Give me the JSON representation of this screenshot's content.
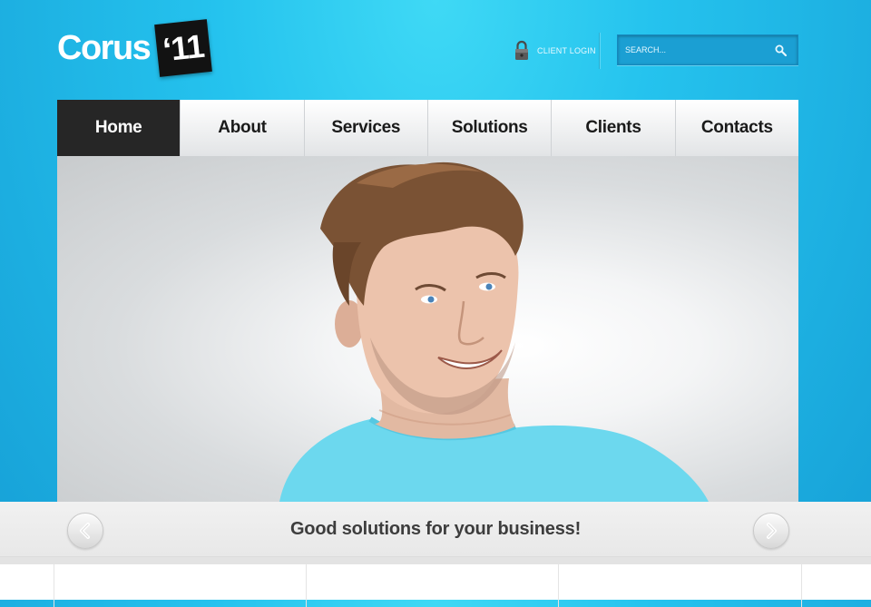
{
  "logo": {
    "text": "Corus",
    "badge": "‘11"
  },
  "header": {
    "client_login": {
      "label": "CLIENT LOGIN",
      "icon": "lock-icon"
    },
    "search": {
      "placeholder": "SEARCH...",
      "icon": "search-icon"
    }
  },
  "nav": {
    "items": [
      {
        "label": "Home",
        "active": true
      },
      {
        "label": "About"
      },
      {
        "label": "Services"
      },
      {
        "label": "Solutions"
      },
      {
        "label": "Clients"
      },
      {
        "label": "Contacts"
      }
    ]
  },
  "slider": {
    "caption": "Good solutions for your business!",
    "prev_icon": "chevron-left-icon",
    "next_icon": "chevron-right-icon"
  },
  "colors": {
    "background": "#25c3ee",
    "nav_active": "#262626",
    "nav_inactive": "#f0f1f2",
    "caption_text": "#3d3d3d"
  }
}
